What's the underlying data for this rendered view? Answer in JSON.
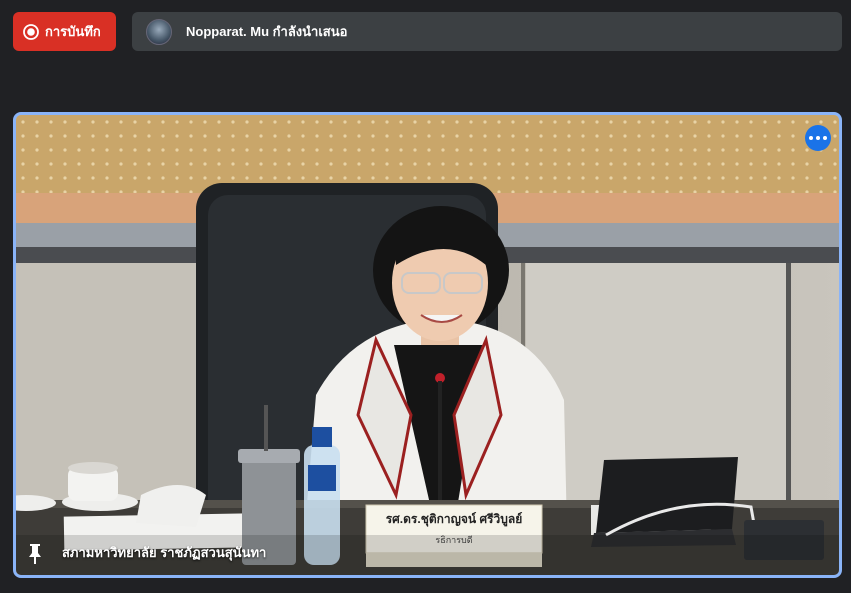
{
  "recording": {
    "label": "การบันทึก",
    "icon": "record-icon",
    "color": "#d93025"
  },
  "presenter_bar": {
    "text": "Nopparat. Mu กำลังนำเสนอ"
  },
  "video_tile": {
    "participant_name": "สภามหาวิทยาลัย ราชภัฏสวนสุนันทา",
    "name_plate": {
      "name": "รศ.ดร.ชุติกาญจน์ ศรีวิบูลย์",
      "title": "รธิการบดี"
    },
    "border_color": "#8ab4f8",
    "more_options_icon": "more-options-icon",
    "pin_icon": "pin-icon"
  }
}
